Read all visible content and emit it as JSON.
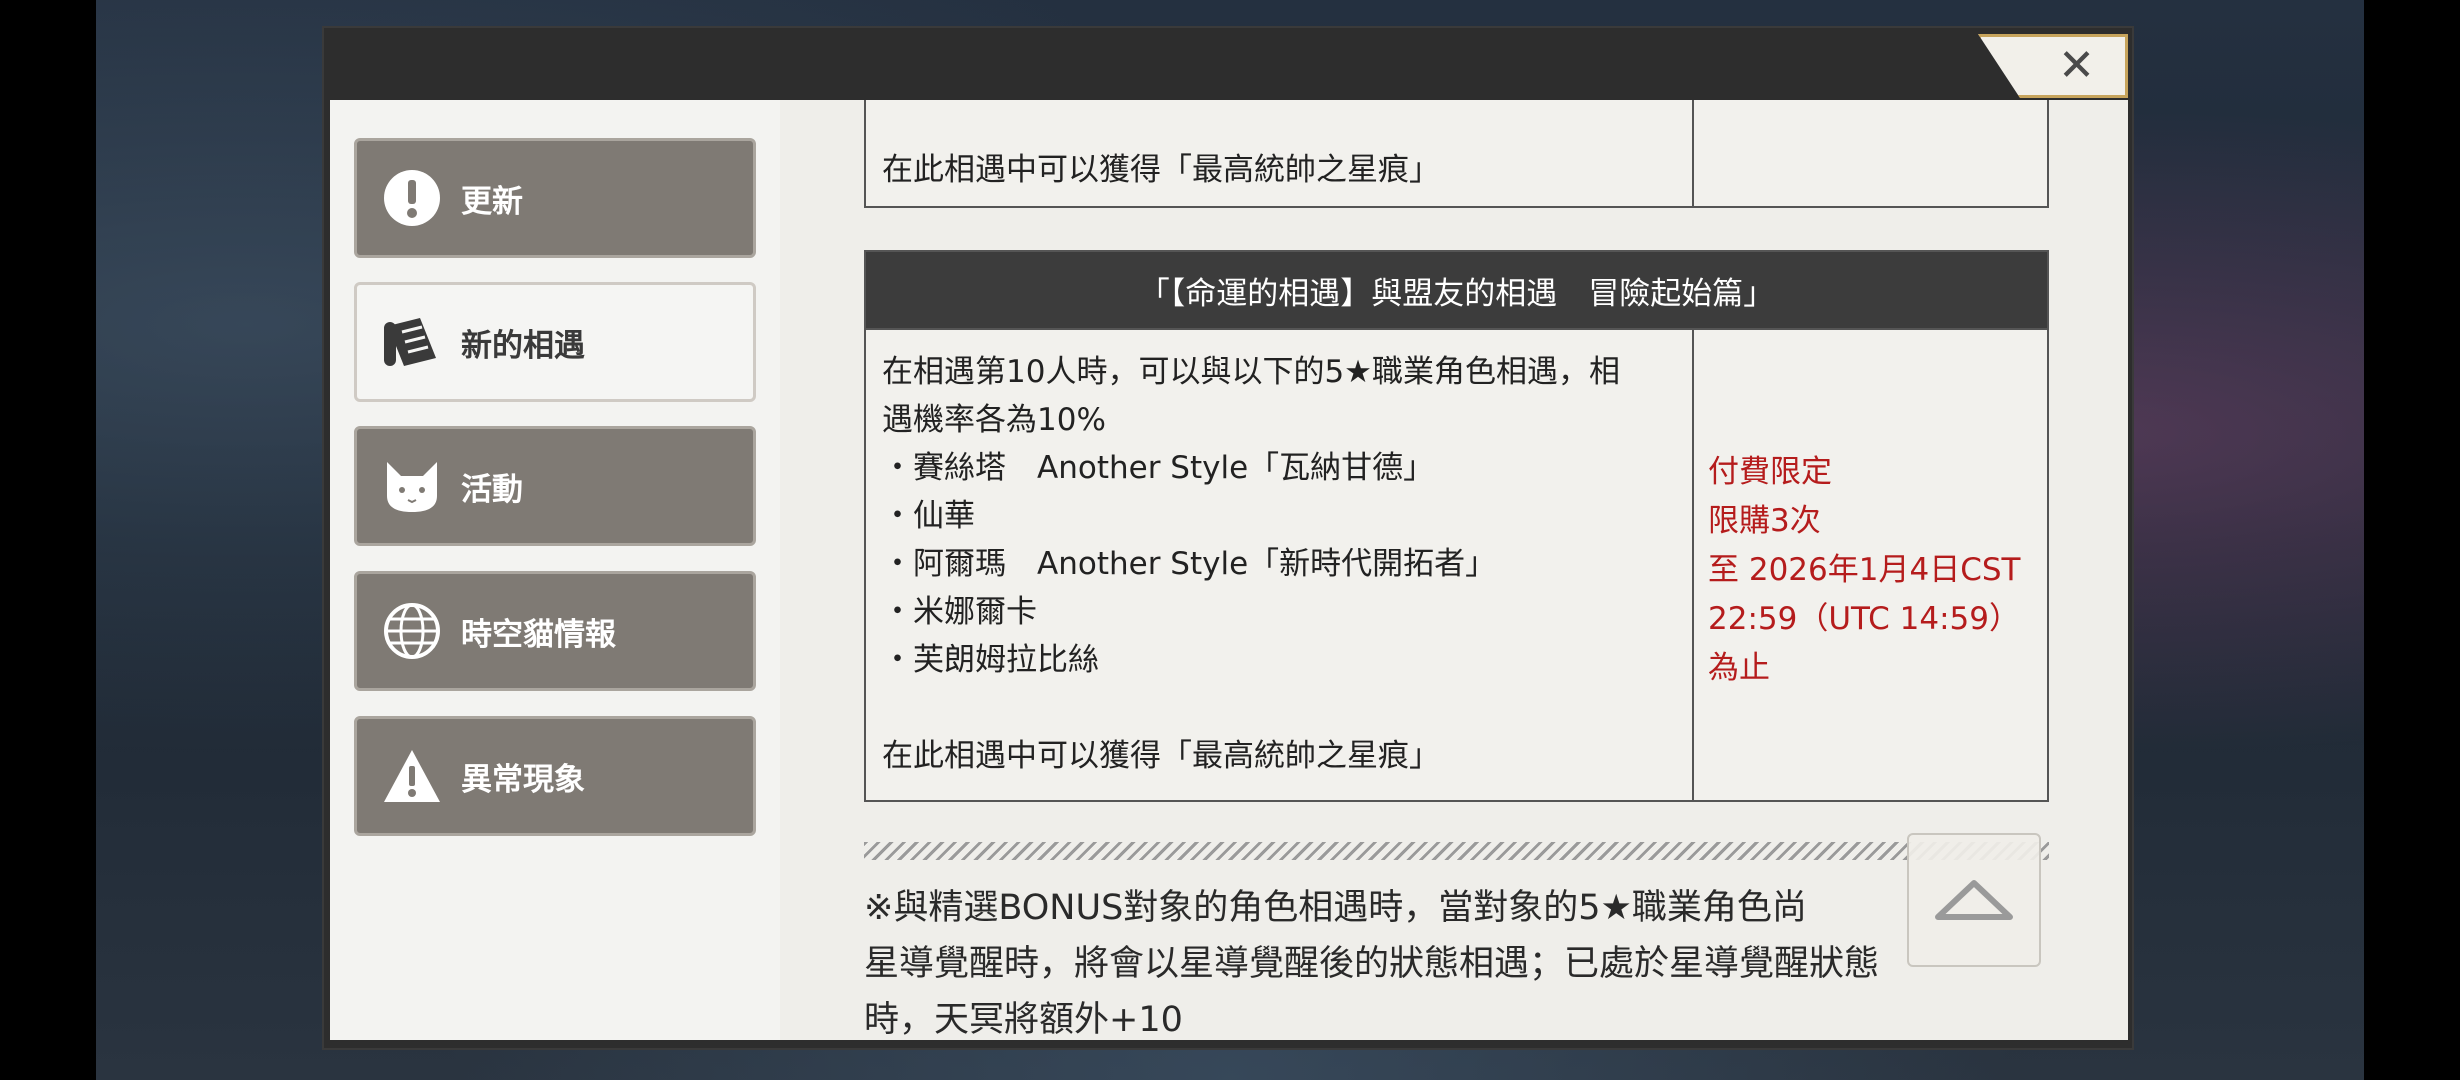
{
  "nav": {
    "items": [
      {
        "label": "更新",
        "icon": "exclamation-icon",
        "active": false
      },
      {
        "label": "新的相遇",
        "icon": "scroll-icon",
        "active": true
      },
      {
        "label": "活動",
        "icon": "cat-icon",
        "active": false
      },
      {
        "label": "時空貓情報",
        "icon": "globe-icon",
        "active": false
      },
      {
        "label": "異常現象",
        "icon": "warning-icon",
        "active": false
      }
    ]
  },
  "content": {
    "top_table_text": "在此相遇中可以獲得「最高統帥之星痕」",
    "table2": {
      "header": "「【命運的相遇】與盟友的相遇　冒險起始篇」",
      "intro_line1": "在相遇第10人時，可以與以下的5★職業角色相遇，相",
      "intro_line2": "遇機率各為10%",
      "characters": [
        "・賽絲塔　Another Style「瓦納甘德」",
        "・仙華",
        "・阿爾瑪　Another Style「新時代開拓者」",
        "・米娜爾卡",
        "・芙朗姆拉比絲"
      ],
      "footer_text": "在此相遇中可以獲得「最高統帥之星痕」",
      "side_lines": [
        "付費限定",
        "限購3次",
        "至 2026年1月4日CST",
        "22:59（UTC 14:59）",
        "為止"
      ]
    },
    "note_line1": "※與精選BONUS對象的角色相遇時，當對象的5★職業角色尚",
    "note_line2": "星導覺醒時，將會以星導覺醒後的狀態相遇；已處於星導覺醒狀態",
    "note_line3": "時，天冥將額外+10"
  },
  "colors": {
    "accent_red": "#b51c1c",
    "header_dark": "#3c3c3c",
    "nav_inactive": "#7f7a74",
    "close_border": "#c7a45c"
  }
}
